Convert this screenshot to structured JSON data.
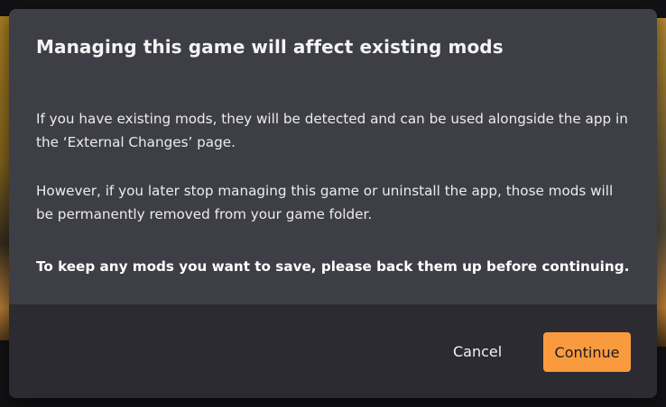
{
  "dialog": {
    "title": "Managing this game will affect existing mods",
    "paragraph_1": "If you have existing mods, they will be detected and can be used alongside the app in the ‘External Changes’ page.",
    "paragraph_2": "However, if you later stop managing this game or uninstall the app, those mods will be permanently removed from your game folder.",
    "paragraph_3": "To keep any mods you want to save, please back them up before continuing.",
    "cancel_label": "Cancel",
    "continue_label": "Continue",
    "accent_color": "#f99a3e"
  }
}
